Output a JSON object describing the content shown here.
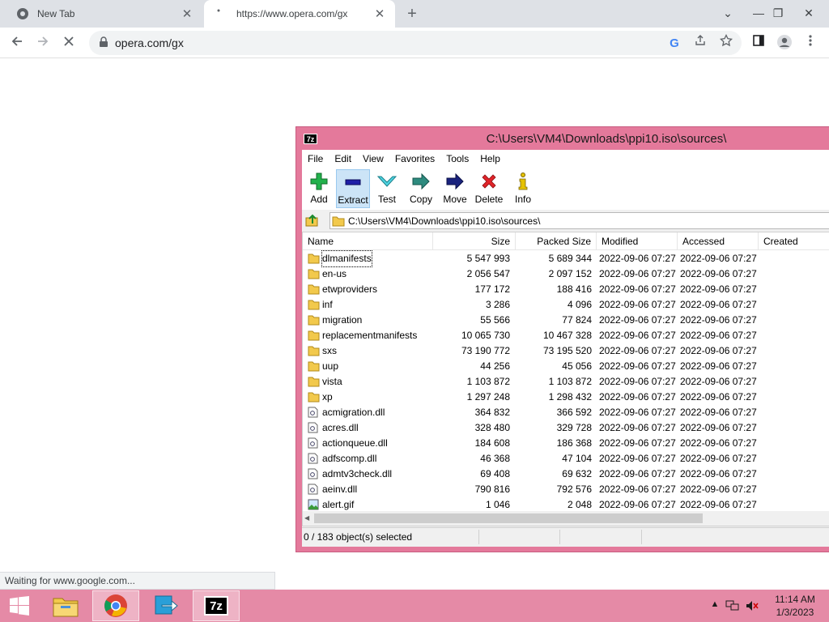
{
  "browser": {
    "tabs": [
      {
        "title": "New Tab",
        "close": "✕"
      },
      {
        "title": "https://www.opera.com/gx",
        "close": "✕"
      }
    ],
    "new_tab": "+",
    "url": "opera.com/gx",
    "status_text": "Waiting for www.google.com...",
    "window_controls": {
      "menu": "⌄",
      "minimize": "—",
      "restore": "❐",
      "close": "✕"
    }
  },
  "zip": {
    "title": "C:\\Users\\VM4\\Downloads\\ppi10.iso\\sources\\",
    "logo": "7z",
    "menu": [
      "File",
      "Edit",
      "View",
      "Favorites",
      "Tools",
      "Help"
    ],
    "tools": [
      "Add",
      "Extract",
      "Test",
      "Copy",
      "Move",
      "Delete",
      "Info"
    ],
    "path": "C:\\Users\\VM4\\Downloads\\ppi10.iso\\sources\\",
    "columns": [
      "Name",
      "Size",
      "Packed Size",
      "Modified",
      "Accessed",
      "Created"
    ],
    "rows": [
      {
        "name": "dlmanifests",
        "type": "folder",
        "size": "5 547 993",
        "packed": "5 689 344",
        "modified": "2022-09-06 07:27",
        "accessed": "2022-09-06 07:27"
      },
      {
        "name": "en-us",
        "type": "folder",
        "size": "2 056 547",
        "packed": "2 097 152",
        "modified": "2022-09-06 07:27",
        "accessed": "2022-09-06 07:27"
      },
      {
        "name": "etwproviders",
        "type": "folder",
        "size": "177 172",
        "packed": "188 416",
        "modified": "2022-09-06 07:27",
        "accessed": "2022-09-06 07:27"
      },
      {
        "name": "inf",
        "type": "folder",
        "size": "3 286",
        "packed": "4 096",
        "modified": "2022-09-06 07:27",
        "accessed": "2022-09-06 07:27"
      },
      {
        "name": "migration",
        "type": "folder",
        "size": "55 566",
        "packed": "77 824",
        "modified": "2022-09-06 07:27",
        "accessed": "2022-09-06 07:27"
      },
      {
        "name": "replacementmanifests",
        "type": "folder",
        "size": "10 065 730",
        "packed": "10 467 328",
        "modified": "2022-09-06 07:27",
        "accessed": "2022-09-06 07:27"
      },
      {
        "name": "sxs",
        "type": "folder",
        "size": "73 190 772",
        "packed": "73 195 520",
        "modified": "2022-09-06 07:27",
        "accessed": "2022-09-06 07:27"
      },
      {
        "name": "uup",
        "type": "folder",
        "size": "44 256",
        "packed": "45 056",
        "modified": "2022-09-06 07:27",
        "accessed": "2022-09-06 07:27"
      },
      {
        "name": "vista",
        "type": "folder",
        "size": "1 103 872",
        "packed": "1 103 872",
        "modified": "2022-09-06 07:27",
        "accessed": "2022-09-06 07:27"
      },
      {
        "name": "xp",
        "type": "folder",
        "size": "1 297 248",
        "packed": "1 298 432",
        "modified": "2022-09-06 07:27",
        "accessed": "2022-09-06 07:27"
      },
      {
        "name": "acmigration.dll",
        "type": "dll",
        "size": "364 832",
        "packed": "366 592",
        "modified": "2022-09-06 07:27",
        "accessed": "2022-09-06 07:27"
      },
      {
        "name": "acres.dll",
        "type": "dll",
        "size": "328 480",
        "packed": "329 728",
        "modified": "2022-09-06 07:27",
        "accessed": "2022-09-06 07:27"
      },
      {
        "name": "actionqueue.dll",
        "type": "dll",
        "size": "184 608",
        "packed": "186 368",
        "modified": "2022-09-06 07:27",
        "accessed": "2022-09-06 07:27"
      },
      {
        "name": "adfscomp.dll",
        "type": "dll",
        "size": "46 368",
        "packed": "47 104",
        "modified": "2022-09-06 07:27",
        "accessed": "2022-09-06 07:27"
      },
      {
        "name": "admtv3check.dll",
        "type": "dll",
        "size": "69 408",
        "packed": "69 632",
        "modified": "2022-09-06 07:27",
        "accessed": "2022-09-06 07:27"
      },
      {
        "name": "aeinv.dll",
        "type": "dll",
        "size": "790 816",
        "packed": "792 576",
        "modified": "2022-09-06 07:27",
        "accessed": "2022-09-06 07:27"
      },
      {
        "name": "alert.gif",
        "type": "image",
        "size": "1 046",
        "packed": "2 048",
        "modified": "2022-09-06 07:27",
        "accessed": "2022-09-06 07:27"
      }
    ],
    "status": "0 / 183 object(s) selected"
  },
  "taskbar": {
    "time": "11:14 AM",
    "date": "1/3/2023"
  }
}
